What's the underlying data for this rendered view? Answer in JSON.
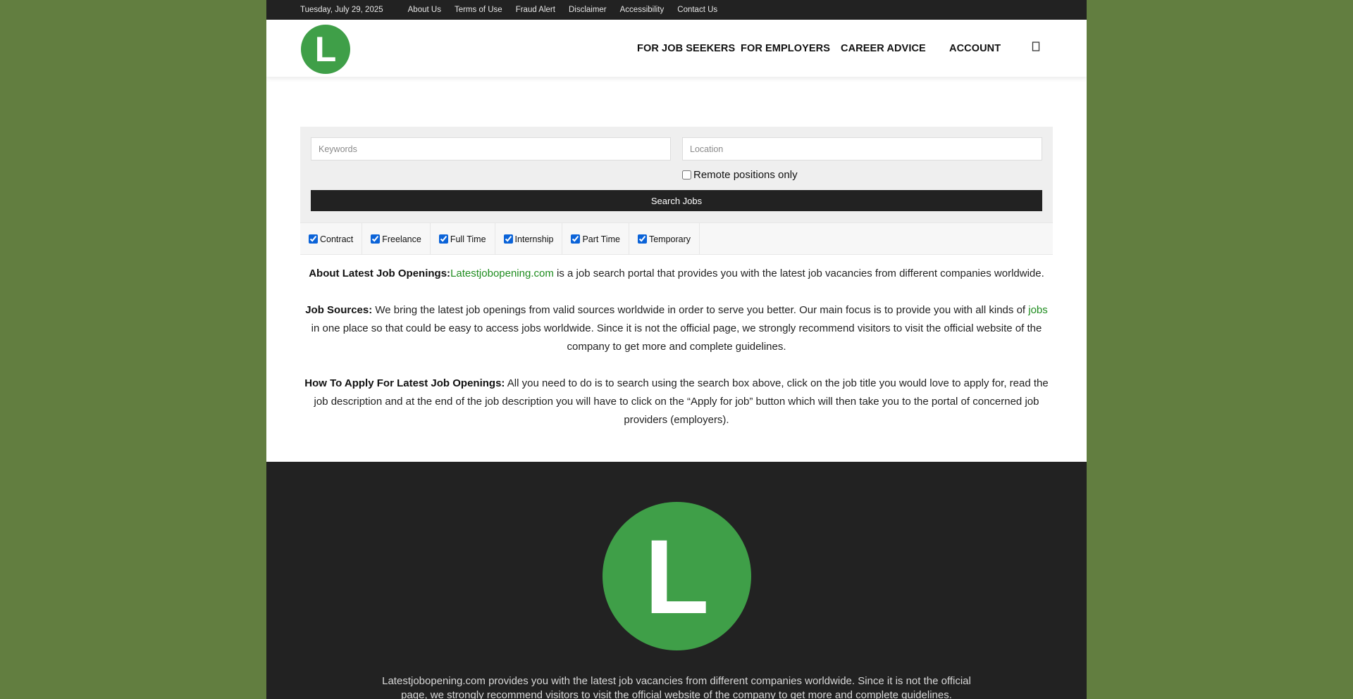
{
  "topbar": {
    "date": "Tuesday, July 29, 2025",
    "links": [
      "About Us",
      "Terms of Use",
      "Fraud Alert",
      "Disclaimer",
      "Accessibility",
      "Contact Us"
    ]
  },
  "header": {
    "logo_letter": "L",
    "nav": [
      "FOR JOB SEEKERS",
      "FOR EMPLOYERS",
      "CAREER ADVICE",
      "ACCOUNT"
    ],
    "search_icon": "search-icon"
  },
  "search": {
    "keywords_placeholder": "Keywords",
    "location_placeholder": "Location",
    "remote_label": "Remote positions only",
    "remote_checked": false,
    "button_label": "Search Jobs"
  },
  "job_types": [
    {
      "label": "Contract",
      "checked": true
    },
    {
      "label": "Freelance",
      "checked": true
    },
    {
      "label": "Full Time",
      "checked": true
    },
    {
      "label": "Internship",
      "checked": true
    },
    {
      "label": "Part Time",
      "checked": true
    },
    {
      "label": "Temporary",
      "checked": true
    }
  ],
  "content": {
    "about_heading": "About Latest Job Openings:",
    "about_link": "Latestjobopening.com",
    "about_text": " is a job search portal that provides you with the latest job vacancies from different companies worldwide.",
    "sources_heading": "Job Sources:",
    "sources_text_1": " We bring the latest job openings from valid sources worldwide in order to serve you better. Our main focus is to provide you with all kinds of ",
    "sources_link": "jobs",
    "sources_text_2": " in one place so that could be easy to access jobs worldwide. Since it is not the official page, we strongly recommend visitors to visit the official website of the company to get more and complete guidelines.",
    "apply_heading": "How To Apply For Latest Job Openings:",
    "apply_text": " All you need to do is to search using the search box above, click on the job title you would love to apply for, read the job description and at the end of the job description you will have to click on the “Apply for job” button which will then take you to the portal of concerned job providers (employers)."
  },
  "footer": {
    "logo_letter": "L",
    "text": "Latestjobopening.com provides you with the latest job vacancies from different companies worldwide. Since it is not the official page, we strongly recommend visitors to visit the official website of the company to get more and complete guidelines."
  },
  "colors": {
    "page_bg": "#627e40",
    "dark": "#222222",
    "logo_green": "#3f9f48",
    "link_green": "#1e8c1e"
  }
}
